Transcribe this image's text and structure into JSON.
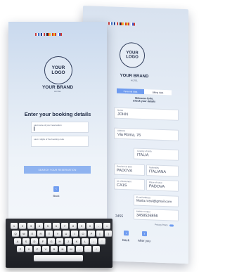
{
  "flag_colors": [
    [
      "#c63b3b",
      "#ffffff",
      "#3b6fc6"
    ],
    [
      "#1f3f8f",
      "#ffffff",
      "#c63b3b"
    ],
    [
      "#2b2b2b",
      "#d63b2b",
      "#f2c230"
    ],
    [
      "#d63b2b",
      "#f2c230",
      "#d63b2b"
    ],
    [
      "#ffffff",
      "#3b5fd6",
      "#d63b2b"
    ]
  ],
  "back_screen": {
    "logo_line1": "YOUR",
    "logo_line2": "LOGO",
    "brand": "YOUR BRAND",
    "hotel": "HOTEL",
    "tab_active": "Personal data",
    "tab_idle": "Billing data",
    "welcome_line1": "Welcome John,",
    "welcome_line2": "Check your details",
    "fields": {
      "name_label": "Name",
      "name_value": "JOHN",
      "address_label": "Address",
      "address_value": "Via Roma, 76",
      "country_label": "Country of birth",
      "country_value": "ITALIA",
      "province_label": "Province of birth",
      "province_value": "PADOVA",
      "nationality_label": "Nationality",
      "nationality_value": "ITALIANA",
      "doc_label": "Id. of document",
      "doc_value": "CA1S",
      "place_label": "Place of issue",
      "place_value": "PADOVA",
      "email_label": "E-mail address",
      "email_value": "Maria.rossi@gmail.com",
      "mobile_label": "Mobile number",
      "mobile_value": "3458526856",
      "phone_prefix": "3455",
      "side_label": "Gender"
    },
    "back_label": "Back",
    "after_label": "After you",
    "privacy_label": "Privacy Policy"
  },
  "front_screen": {
    "logo_line1": "YOUR",
    "logo_line2": "LOGO",
    "brand": "YOUR BRAND",
    "hotel": "HOTEL",
    "heading": "Enter your booking details",
    "input1_placeholder": "Last name of your reservation",
    "input2_placeholder": "Last 4 digits of the booking code",
    "primary_button": "SEARCH YOUR RESERVATION",
    "back_label": "Back"
  },
  "keyboard_rows": [
    [
      "1",
      "2",
      "3",
      "4",
      "5",
      "6",
      "7",
      "8",
      "9",
      "0",
      "-",
      "="
    ],
    [
      "Q",
      "W",
      "E",
      "R",
      "T",
      "Y",
      "U",
      "I",
      "O",
      "P",
      "[",
      "]"
    ],
    [
      "A",
      "S",
      "D",
      "F",
      "G",
      "H",
      "J",
      "K",
      "L",
      ";",
      "'"
    ],
    [
      "Z",
      "X",
      "C",
      "V",
      "B",
      "N",
      "M",
      ",",
      ".",
      "/"
    ]
  ]
}
